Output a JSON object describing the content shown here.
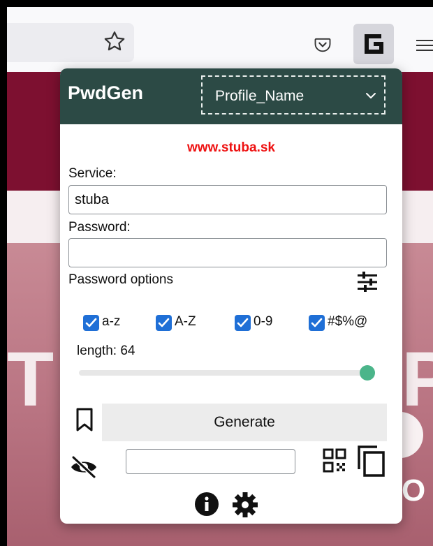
{
  "browser": {
    "toolbar_icons": [
      "star-icon",
      "pocket-icon",
      "pwdgen-extension-icon",
      "hamburger-menu-icon"
    ],
    "extension_glyph": "G"
  },
  "page_background": {
    "band_color": "#7d1030",
    "letters_left": "TE",
    "letters_right": "P",
    "nav_arrow": "›",
    "trailing_letter": "O"
  },
  "popup": {
    "title": "PwdGen",
    "header_color": "#2c4a45",
    "profile_select": {
      "selected": "Profile_Name"
    },
    "site": "www.stuba.sk",
    "site_color": "#ee1111",
    "service": {
      "label": "Service:",
      "value": "stuba"
    },
    "password": {
      "label": "Password:",
      "value": ""
    },
    "options": {
      "label": "Password options",
      "checkboxes": [
        {
          "label": "a-z",
          "checked": true
        },
        {
          "label": "A-Z",
          "checked": true
        },
        {
          "label": "0-9",
          "checked": true
        },
        {
          "label": "#$%@",
          "checked": true
        }
      ],
      "length_label": "length: 64",
      "length_fraction": 1.0
    },
    "generate_label": "Generate",
    "output_value": "",
    "accent_color": "#1f6fd6",
    "slider_color": "#4bb58a",
    "footer_icons": [
      "info-icon",
      "settings-gear-icon"
    ]
  }
}
